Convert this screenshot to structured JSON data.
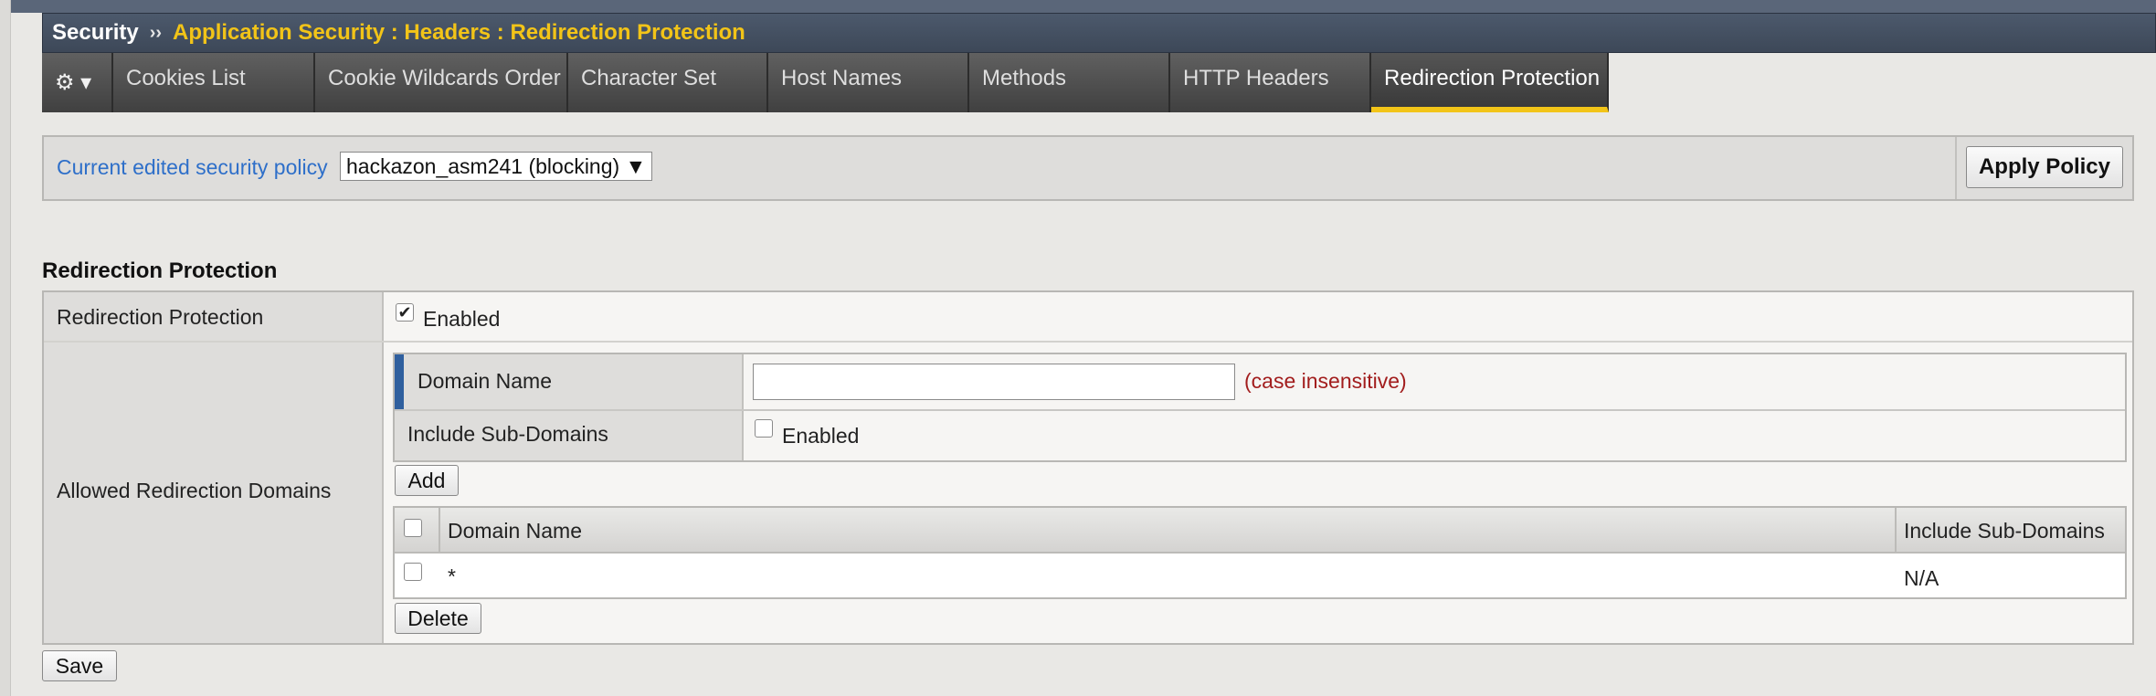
{
  "breadcrumb": {
    "root": "Security",
    "separator": "››",
    "path": "Application Security : Headers : Redirection Protection"
  },
  "tabs": {
    "gear": "⚙ ▾",
    "items": [
      {
        "label": "Cookies List"
      },
      {
        "label": "Cookie Wildcards Order"
      },
      {
        "label": "Character Set"
      },
      {
        "label": "Host Names"
      },
      {
        "label": "Methods"
      },
      {
        "label": "HTTP Headers"
      },
      {
        "label": "Redirection Protection",
        "active": true
      }
    ]
  },
  "policy": {
    "label": "Current edited security policy",
    "selected": "hackazon_asm241 (blocking) ▼",
    "apply_label": "Apply Policy"
  },
  "section_title": "Redirection Protection",
  "form": {
    "redirection_label": "Redirection Protection",
    "redirection_checked": "✔",
    "redirection_enabled_text": "Enabled",
    "allowed_domains_label": "Allowed Redirection Domains",
    "add": {
      "domain_name_label": "Domain Name",
      "domain_name_value": "",
      "case_note": "(case insensitive)",
      "include_sub_label": "Include Sub-Domains",
      "include_sub_enabled_text": "Enabled",
      "add_button": "Add"
    },
    "list": {
      "headers": [
        "Domain Name",
        "Include Sub-Domains"
      ],
      "rows": [
        {
          "domain": "*",
          "include_sub": "N/A"
        }
      ],
      "delete_button": "Delete"
    },
    "save_button": "Save"
  },
  "colors": {
    "title_bar": "#3d4858",
    "breadcrumb_path": "#f2c418",
    "active_tab_underline": "#f2c418",
    "link_blue": "#2e6fc9",
    "case_note_red": "#a21d1d"
  }
}
